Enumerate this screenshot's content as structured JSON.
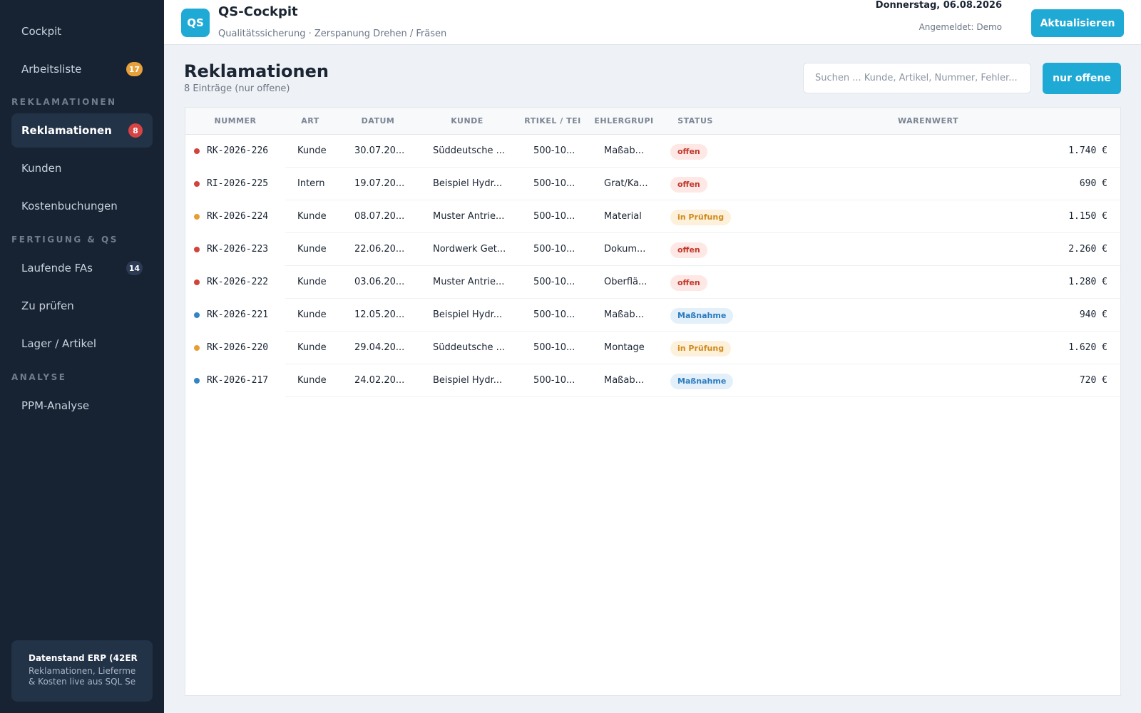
{
  "colors": {
    "sidebar_bg": "#172232",
    "accent": "#1faad6",
    "badge_orange": "#e8a13a",
    "badge_red": "#d84343",
    "badge_navy": "#2b3b54",
    "status_offen": "#c0392b",
    "status_pruefung": "#d08a1c",
    "status_massnahme": "#2b7bbf"
  },
  "sidebar": {
    "top_items": [
      {
        "label": "Cockpit",
        "badge": null
      },
      {
        "label": "Arbeitsliste",
        "badge": "17",
        "badge_color": "orange"
      }
    ],
    "sections": [
      {
        "title": "REKLAMATIONEN",
        "items": [
          {
            "label": "Reklamationen",
            "badge": "8",
            "badge_color": "red",
            "active": true
          },
          {
            "label": "Kunden",
            "badge": null
          },
          {
            "label": "Kostenbuchungen",
            "badge": null
          }
        ]
      },
      {
        "title": "FERTIGUNG & QS",
        "items": [
          {
            "label": "Laufende FAs",
            "badge": "14",
            "badge_color": "navy"
          },
          {
            "label": "Zu prüfen",
            "badge": null
          },
          {
            "label": "Lager / Artikel",
            "badge": null
          }
        ]
      },
      {
        "title": "ANALYSE",
        "items": [
          {
            "label": "PPM-Analyse",
            "badge": null
          }
        ]
      }
    ],
    "footer": {
      "title": "Datenstand ERP (42ER",
      "line1": "Reklamationen, Lieferme",
      "line2": "& Kosten live aus SQL Se"
    }
  },
  "header": {
    "logo_text": "QS",
    "title": "QS-Cockpit",
    "subtitle": "Qualitätssicherung · Zerspanung Drehen / Fräsen",
    "date": "Donnerstag, 06.08.2026",
    "user": "Angemeldet: Demo",
    "refresh_label": "Aktualisieren"
  },
  "main": {
    "title": "Reklamationen",
    "subtitle": "8 Einträge (nur offene)",
    "search_placeholder": "Suchen ... Kunde, Artikel, Nummer, Fehler...",
    "filter_label": "nur offene",
    "columns": [
      "NUMMER",
      "ART",
      "DATUM",
      "KUNDE",
      "RTIKEL / TEI",
      "EHLERGRUPI",
      "STATUS",
      "WARENWERT"
    ],
    "rows": [
      {
        "nummer": "RK-2026-226",
        "art": "Kunde",
        "datum": "30.07.20...",
        "kunde": "Süddeutsche ...",
        "artikel": "500-10...",
        "fehler": "Maßab...",
        "status": "offen",
        "status_type": "offen",
        "wert": "1.740 €"
      },
      {
        "nummer": "RI-2026-225",
        "art": "Intern",
        "datum": "19.07.20...",
        "kunde": "Beispiel Hydr...",
        "artikel": "500-10...",
        "fehler": "Grat/Ka...",
        "status": "offen",
        "status_type": "offen",
        "wert": "690 €"
      },
      {
        "nummer": "RK-2026-224",
        "art": "Kunde",
        "datum": "08.07.20...",
        "kunde": "Muster Antrie...",
        "artikel": "500-10...",
        "fehler": "Material",
        "status": "in Prüfung",
        "status_type": "pruefung",
        "wert": "1.150 €"
      },
      {
        "nummer": "RK-2026-223",
        "art": "Kunde",
        "datum": "22.06.20...",
        "kunde": "Nordwerk Get...",
        "artikel": "500-10...",
        "fehler": "Dokum...",
        "status": "offen",
        "status_type": "offen",
        "wert": "2.260 €"
      },
      {
        "nummer": "RK-2026-222",
        "art": "Kunde",
        "datum": "03.06.20...",
        "kunde": "Muster Antrie...",
        "artikel": "500-10...",
        "fehler": "Oberflä...",
        "status": "offen",
        "status_type": "offen",
        "wert": "1.280 €"
      },
      {
        "nummer": "RK-2026-221",
        "art": "Kunde",
        "datum": "12.05.20...",
        "kunde": "Beispiel Hydr...",
        "artikel": "500-10...",
        "fehler": "Maßab...",
        "status": "Maßnahme",
        "status_type": "massnahme",
        "wert": "940 €"
      },
      {
        "nummer": "RK-2026-220",
        "art": "Kunde",
        "datum": "29.04.20...",
        "kunde": "Süddeutsche ...",
        "artikel": "500-10...",
        "fehler": "Montage",
        "status": "in Prüfung",
        "status_type": "pruefung",
        "wert": "1.620 €"
      },
      {
        "nummer": "RK-2026-217",
        "art": "Kunde",
        "datum": "24.02.20...",
        "kunde": "Beispiel Hydr...",
        "artikel": "500-10...",
        "fehler": "Maßab...",
        "status": "Maßnahme",
        "status_type": "massnahme",
        "wert": "720 €"
      }
    ]
  }
}
